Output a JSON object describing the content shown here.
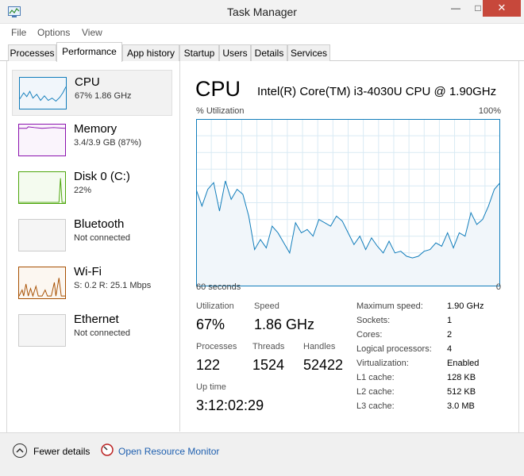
{
  "window": {
    "title": "Task Manager",
    "min": "—",
    "max": "□",
    "close": "✕",
    "icon": "task-manager-icon"
  },
  "menu": [
    "File",
    "Options",
    "View"
  ],
  "tabs": [
    "Processes",
    "Performance",
    "App history",
    "Startup",
    "Users",
    "Details",
    "Services"
  ],
  "active_tab": "Performance",
  "sidebar": [
    {
      "title": "CPU",
      "sub": "67%  1.86 GHz",
      "color": "#117dbb"
    },
    {
      "title": "Memory",
      "sub": "3.4/3.9 GB (87%)",
      "color": "#8b12ae"
    },
    {
      "title": "Disk 0 (C:)",
      "sub": "22%",
      "color": "#4da60c"
    },
    {
      "title": "Bluetooth",
      "sub": "Not connected",
      "color": "#cccccc"
    },
    {
      "title": "Wi-Fi",
      "sub": "S: 0.2  R: 25.1 Mbps",
      "color": "#a74f01"
    },
    {
      "title": "Ethernet",
      "sub": "Not connected",
      "color": "#cccccc"
    }
  ],
  "main": {
    "title": "CPU",
    "model": "Intel(R) Core(TM) i3-4030U CPU @ 1.90GHz",
    "graph_label_left": "% Utilization",
    "graph_label_right": "100%",
    "graph_bottom_left": "60 seconds",
    "graph_bottom_right": "0",
    "stats": {
      "utilization_label": "Utilization",
      "utilization": "67%",
      "speed_label": "Speed",
      "speed": "1.86 GHz",
      "processes_label": "Processes",
      "processes": "122",
      "threads_label": "Threads",
      "threads": "1524",
      "handles_label": "Handles",
      "handles": "52422",
      "uptime_label": "Up time",
      "uptime": "3:12:02:29"
    },
    "specs": [
      {
        "label": "Maximum speed:",
        "value": "1.90 GHz"
      },
      {
        "label": "Sockets:",
        "value": "1"
      },
      {
        "label": "Cores:",
        "value": "2"
      },
      {
        "label": "Logical processors:",
        "value": "4"
      },
      {
        "label": "Virtualization:",
        "value": "Enabled"
      },
      {
        "label": "L1 cache:",
        "value": "128 KB"
      },
      {
        "label": "L2 cache:",
        "value": "512 KB"
      },
      {
        "label": "L3 cache:",
        "value": "3.0 MB"
      }
    ]
  },
  "cpu_history": [
    58,
    48,
    58,
    62,
    45,
    63,
    52,
    58,
    55,
    42,
    22,
    28,
    23,
    36,
    32,
    26,
    20,
    38,
    32,
    34,
    30,
    40,
    38,
    36,
    42,
    39,
    32,
    25,
    30,
    22,
    29,
    24,
    20,
    27,
    20,
    21,
    18,
    17,
    18,
    21,
    22,
    26,
    24,
    32,
    23,
    32,
    30,
    44,
    37,
    40,
    48,
    58,
    62
  ],
  "footer": {
    "fewer": "Fewer details",
    "resource_monitor": "Open Resource Monitor"
  }
}
